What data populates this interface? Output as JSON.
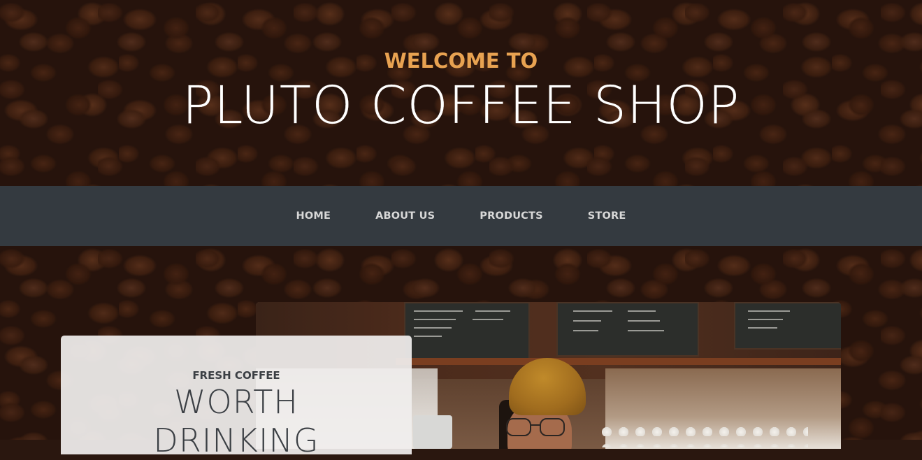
{
  "hero": {
    "welcome": "WELCOME TO",
    "shop_name": "PLUTO COFFEE SHOP"
  },
  "nav": {
    "items": [
      {
        "label": "HOME"
      },
      {
        "label": "ABOUT US"
      },
      {
        "label": "PRODUCTS"
      },
      {
        "label": "STORE"
      }
    ]
  },
  "intro": {
    "subheading": "FRESH COFFEE",
    "heading_line1": "WORTH",
    "heading_line2": "DRINKING"
  },
  "colors": {
    "accent": "#e8a251",
    "nav_background": "#343a40",
    "nav_text": "#d8d8d8",
    "card_background": "#f0eeed",
    "card_text": "#3b3f44"
  }
}
